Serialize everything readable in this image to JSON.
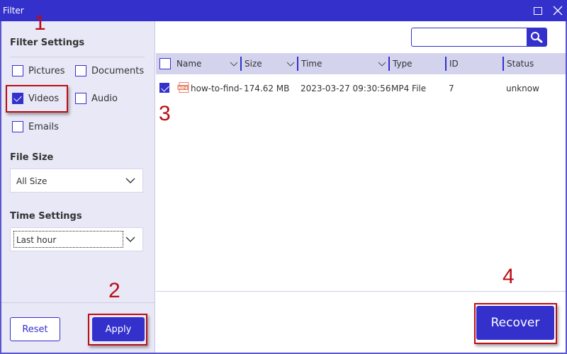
{
  "window": {
    "title": "Filter",
    "maximize_icon": "maximize-icon",
    "close_icon": "close-icon"
  },
  "sidebar": {
    "filter_settings_heading": "Filter Settings",
    "file_types": [
      {
        "label": "Pictures",
        "checked": false
      },
      {
        "label": "Documents",
        "checked": false
      },
      {
        "label": "Videos",
        "checked": true
      },
      {
        "label": "Audio",
        "checked": false
      },
      {
        "label": "Emails",
        "checked": false
      }
    ],
    "file_size_heading": "File Size",
    "file_size_value": "All Size",
    "time_settings_heading": "Time Settings",
    "time_settings_value": "Last hour",
    "reset_label": "Reset",
    "apply_label": "Apply"
  },
  "search": {
    "value": "",
    "placeholder": "",
    "icon": "search-icon"
  },
  "table": {
    "columns": [
      {
        "label": "Name",
        "sortable": true
      },
      {
        "label": "Size",
        "sortable": true
      },
      {
        "label": "Time",
        "sortable": true
      },
      {
        "label": "Type",
        "sortable": false
      },
      {
        "label": "ID",
        "sortable": false
      },
      {
        "label": "Status",
        "sortable": false
      }
    ],
    "header_checked": false,
    "rows": [
      {
        "checked": true,
        "icon": "mp4-file-icon",
        "icon_text": "MP4",
        "name": "how-to-find-",
        "size": "174.62 MB",
        "time": "2023-03-27 09:30:56",
        "type": "MP4 File",
        "id": "7",
        "status": "unknow"
      }
    ]
  },
  "recover_label": "Recover",
  "annotations": {
    "step1": "1",
    "step2": "2",
    "step3": "3",
    "step4": "4",
    "color": "#bb0d14"
  },
  "colors": {
    "accent": "#3330cc",
    "sidebar_bg": "#e8e8f6",
    "header_bg": "#d4d3ee"
  }
}
